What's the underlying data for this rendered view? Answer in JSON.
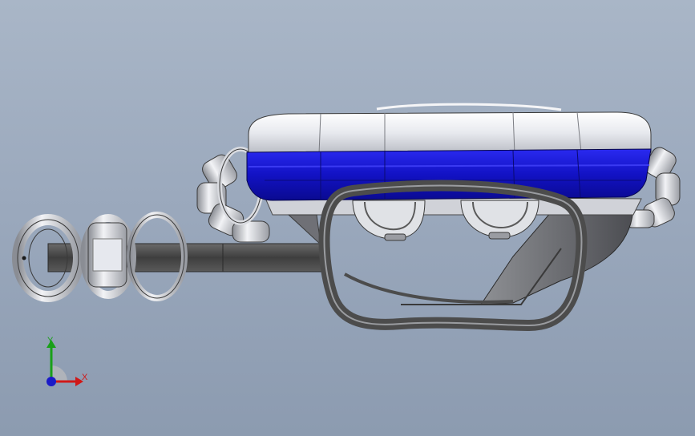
{
  "viewport": {
    "background_top": "#a9b6c7",
    "background_bottom": "#8c9bb0"
  },
  "model": {
    "body_color": "#e6e8ee",
    "band_color": "#1414c8",
    "strap_color": "#4a4a4a",
    "ring_color": "#d9dbe0",
    "frame_color": "#555555"
  },
  "triad": {
    "x_label": "X",
    "y_label": "Y",
    "x_color": "#d01818",
    "y_color": "#19a019",
    "z_color": "#1a1ac8",
    "x_icon": "x-axis-arrow-icon",
    "y_icon": "y-axis-arrow-icon",
    "z_icon": "z-axis-dot-icon"
  }
}
